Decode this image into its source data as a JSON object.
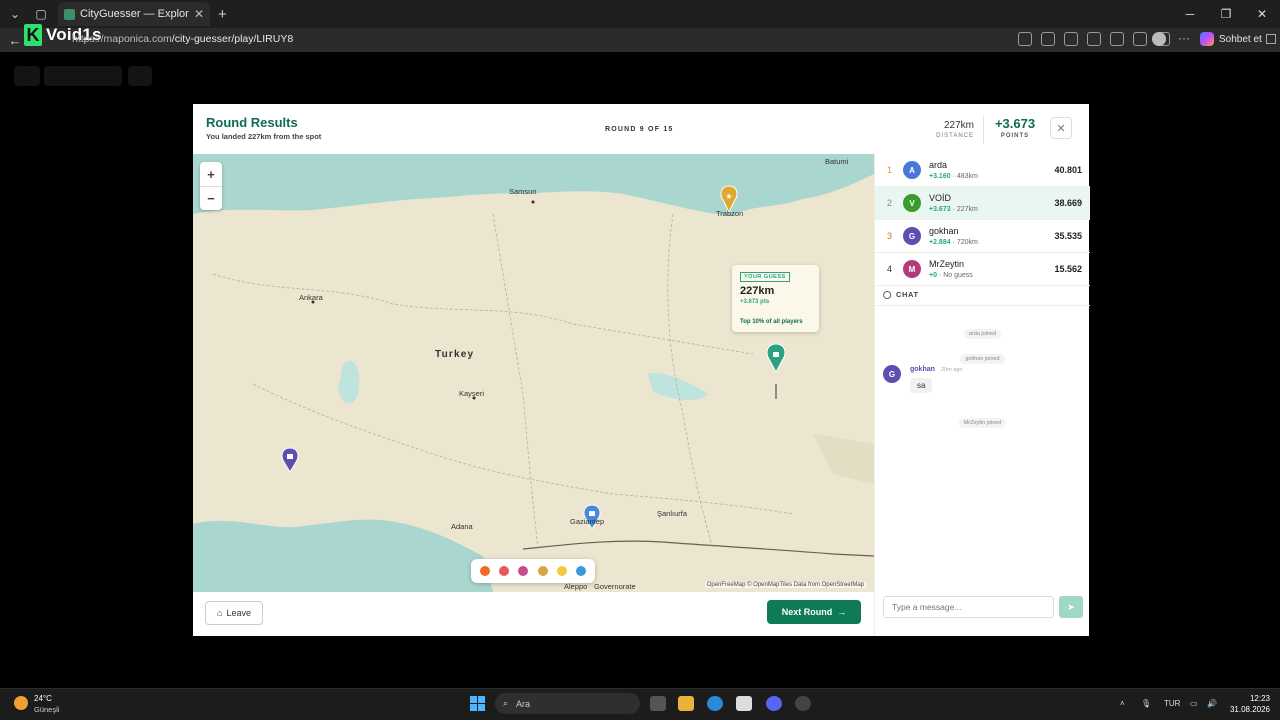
{
  "browser": {
    "tab_title": "CityGuesser — Explore Real C",
    "url_host": "https://maponica.com",
    "url_path": "/city-guesser/play/LIRUY8",
    "logo_text": "Void1s",
    "sohbet_label": "Sohbet et"
  },
  "modal": {
    "title": "Round Results",
    "subtitle": "You landed 227km from the spot",
    "round": "ROUND 9 OF 15",
    "distance_value": "227km",
    "distance_label": "DISTANCE",
    "points_value": "+3.673",
    "points_label": "POINTS"
  },
  "map": {
    "cities": [
      "Batumi",
      "Samsun",
      "Ankara",
      "Trabzon",
      "Kayseri",
      "Adana",
      "Gaziantep",
      "Şanlıurfa",
      "Aleppo",
      "Governorate"
    ],
    "country": "Turkey",
    "attribution": "OpenFreeMap © OpenMapTiles Data from OpenStreetMap",
    "zoom_in": "+",
    "zoom_out": "−"
  },
  "tooltip": {
    "badge": "YOUR GUESS",
    "distance": "227km",
    "points": "+3.673 pts",
    "rank_note": "Top 10% of all players"
  },
  "footer": {
    "leave_label": "Leave",
    "next_label": "Next Round"
  },
  "leaderboard": [
    {
      "rank": "1",
      "initial": "A",
      "name": "arda",
      "gain": "+3.160",
      "detail": "· 483km",
      "score": "40.801",
      "color": "#4a78d8"
    },
    {
      "rank": "2",
      "initial": "V",
      "name": "VOİD",
      "gain": "+3.673",
      "detail": "· 227km",
      "score": "38.669",
      "color": "#3a9a2a"
    },
    {
      "rank": "3",
      "initial": "G",
      "name": "gokhan",
      "gain": "+2.884",
      "detail": "· 720km",
      "score": "35.535",
      "color": "#5c4fb1"
    },
    {
      "rank": "4",
      "initial": "M",
      "name": "MrZeytin",
      "gain": "+0",
      "detail": "· No guess",
      "score": "15.562",
      "color": "#b03c7a"
    }
  ],
  "chat": {
    "header": "CHAT",
    "system_messages": [
      "arda joined",
      "gokhan joined",
      "MrZeytin joined"
    ],
    "message": {
      "initial": "G",
      "author": "gokhan",
      "time": "20m ago",
      "text": "sa"
    },
    "input_placeholder": "Type a message..."
  },
  "taskbar": {
    "temperature": "24°C",
    "weather": "Güneşli",
    "search_placeholder": "Ara",
    "language": "TUR",
    "time": "12:23",
    "date": "31.08.2026"
  }
}
